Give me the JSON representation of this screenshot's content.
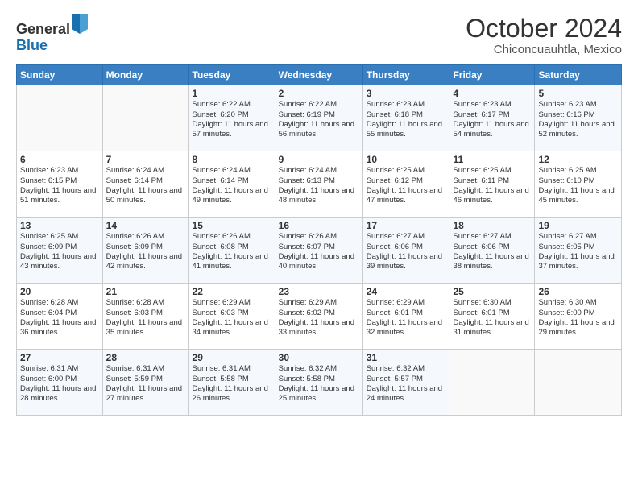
{
  "logo": {
    "general": "General",
    "blue": "Blue"
  },
  "title": "October 2024",
  "subtitle": "Chiconcuauhtla, Mexico",
  "days_header": [
    "Sunday",
    "Monday",
    "Tuesday",
    "Wednesday",
    "Thursday",
    "Friday",
    "Saturday"
  ],
  "weeks": [
    [
      {
        "day": "",
        "sunrise": "",
        "sunset": "",
        "daylight": ""
      },
      {
        "day": "",
        "sunrise": "",
        "sunset": "",
        "daylight": ""
      },
      {
        "day": "1",
        "sunrise": "Sunrise: 6:22 AM",
        "sunset": "Sunset: 6:20 PM",
        "daylight": "Daylight: 11 hours and 57 minutes."
      },
      {
        "day": "2",
        "sunrise": "Sunrise: 6:22 AM",
        "sunset": "Sunset: 6:19 PM",
        "daylight": "Daylight: 11 hours and 56 minutes."
      },
      {
        "day": "3",
        "sunrise": "Sunrise: 6:23 AM",
        "sunset": "Sunset: 6:18 PM",
        "daylight": "Daylight: 11 hours and 55 minutes."
      },
      {
        "day": "4",
        "sunrise": "Sunrise: 6:23 AM",
        "sunset": "Sunset: 6:17 PM",
        "daylight": "Daylight: 11 hours and 54 minutes."
      },
      {
        "day": "5",
        "sunrise": "Sunrise: 6:23 AM",
        "sunset": "Sunset: 6:16 PM",
        "daylight": "Daylight: 11 hours and 52 minutes."
      }
    ],
    [
      {
        "day": "6",
        "sunrise": "Sunrise: 6:23 AM",
        "sunset": "Sunset: 6:15 PM",
        "daylight": "Daylight: 11 hours and 51 minutes."
      },
      {
        "day": "7",
        "sunrise": "Sunrise: 6:24 AM",
        "sunset": "Sunset: 6:14 PM",
        "daylight": "Daylight: 11 hours and 50 minutes."
      },
      {
        "day": "8",
        "sunrise": "Sunrise: 6:24 AM",
        "sunset": "Sunset: 6:14 PM",
        "daylight": "Daylight: 11 hours and 49 minutes."
      },
      {
        "day": "9",
        "sunrise": "Sunrise: 6:24 AM",
        "sunset": "Sunset: 6:13 PM",
        "daylight": "Daylight: 11 hours and 48 minutes."
      },
      {
        "day": "10",
        "sunrise": "Sunrise: 6:25 AM",
        "sunset": "Sunset: 6:12 PM",
        "daylight": "Daylight: 11 hours and 47 minutes."
      },
      {
        "day": "11",
        "sunrise": "Sunrise: 6:25 AM",
        "sunset": "Sunset: 6:11 PM",
        "daylight": "Daylight: 11 hours and 46 minutes."
      },
      {
        "day": "12",
        "sunrise": "Sunrise: 6:25 AM",
        "sunset": "Sunset: 6:10 PM",
        "daylight": "Daylight: 11 hours and 45 minutes."
      }
    ],
    [
      {
        "day": "13",
        "sunrise": "Sunrise: 6:25 AM",
        "sunset": "Sunset: 6:09 PM",
        "daylight": "Daylight: 11 hours and 43 minutes."
      },
      {
        "day": "14",
        "sunrise": "Sunrise: 6:26 AM",
        "sunset": "Sunset: 6:09 PM",
        "daylight": "Daylight: 11 hours and 42 minutes."
      },
      {
        "day": "15",
        "sunrise": "Sunrise: 6:26 AM",
        "sunset": "Sunset: 6:08 PM",
        "daylight": "Daylight: 11 hours and 41 minutes."
      },
      {
        "day": "16",
        "sunrise": "Sunrise: 6:26 AM",
        "sunset": "Sunset: 6:07 PM",
        "daylight": "Daylight: 11 hours and 40 minutes."
      },
      {
        "day": "17",
        "sunrise": "Sunrise: 6:27 AM",
        "sunset": "Sunset: 6:06 PM",
        "daylight": "Daylight: 11 hours and 39 minutes."
      },
      {
        "day": "18",
        "sunrise": "Sunrise: 6:27 AM",
        "sunset": "Sunset: 6:06 PM",
        "daylight": "Daylight: 11 hours and 38 minutes."
      },
      {
        "day": "19",
        "sunrise": "Sunrise: 6:27 AM",
        "sunset": "Sunset: 6:05 PM",
        "daylight": "Daylight: 11 hours and 37 minutes."
      }
    ],
    [
      {
        "day": "20",
        "sunrise": "Sunrise: 6:28 AM",
        "sunset": "Sunset: 6:04 PM",
        "daylight": "Daylight: 11 hours and 36 minutes."
      },
      {
        "day": "21",
        "sunrise": "Sunrise: 6:28 AM",
        "sunset": "Sunset: 6:03 PM",
        "daylight": "Daylight: 11 hours and 35 minutes."
      },
      {
        "day": "22",
        "sunrise": "Sunrise: 6:29 AM",
        "sunset": "Sunset: 6:03 PM",
        "daylight": "Daylight: 11 hours and 34 minutes."
      },
      {
        "day": "23",
        "sunrise": "Sunrise: 6:29 AM",
        "sunset": "Sunset: 6:02 PM",
        "daylight": "Daylight: 11 hours and 33 minutes."
      },
      {
        "day": "24",
        "sunrise": "Sunrise: 6:29 AM",
        "sunset": "Sunset: 6:01 PM",
        "daylight": "Daylight: 11 hours and 32 minutes."
      },
      {
        "day": "25",
        "sunrise": "Sunrise: 6:30 AM",
        "sunset": "Sunset: 6:01 PM",
        "daylight": "Daylight: 11 hours and 31 minutes."
      },
      {
        "day": "26",
        "sunrise": "Sunrise: 6:30 AM",
        "sunset": "Sunset: 6:00 PM",
        "daylight": "Daylight: 11 hours and 29 minutes."
      }
    ],
    [
      {
        "day": "27",
        "sunrise": "Sunrise: 6:31 AM",
        "sunset": "Sunset: 6:00 PM",
        "daylight": "Daylight: 11 hours and 28 minutes."
      },
      {
        "day": "28",
        "sunrise": "Sunrise: 6:31 AM",
        "sunset": "Sunset: 5:59 PM",
        "daylight": "Daylight: 11 hours and 27 minutes."
      },
      {
        "day": "29",
        "sunrise": "Sunrise: 6:31 AM",
        "sunset": "Sunset: 5:58 PM",
        "daylight": "Daylight: 11 hours and 26 minutes."
      },
      {
        "day": "30",
        "sunrise": "Sunrise: 6:32 AM",
        "sunset": "Sunset: 5:58 PM",
        "daylight": "Daylight: 11 hours and 25 minutes."
      },
      {
        "day": "31",
        "sunrise": "Sunrise: 6:32 AM",
        "sunset": "Sunset: 5:57 PM",
        "daylight": "Daylight: 11 hours and 24 minutes."
      },
      {
        "day": "",
        "sunrise": "",
        "sunset": "",
        "daylight": ""
      },
      {
        "day": "",
        "sunrise": "",
        "sunset": "",
        "daylight": ""
      }
    ]
  ]
}
